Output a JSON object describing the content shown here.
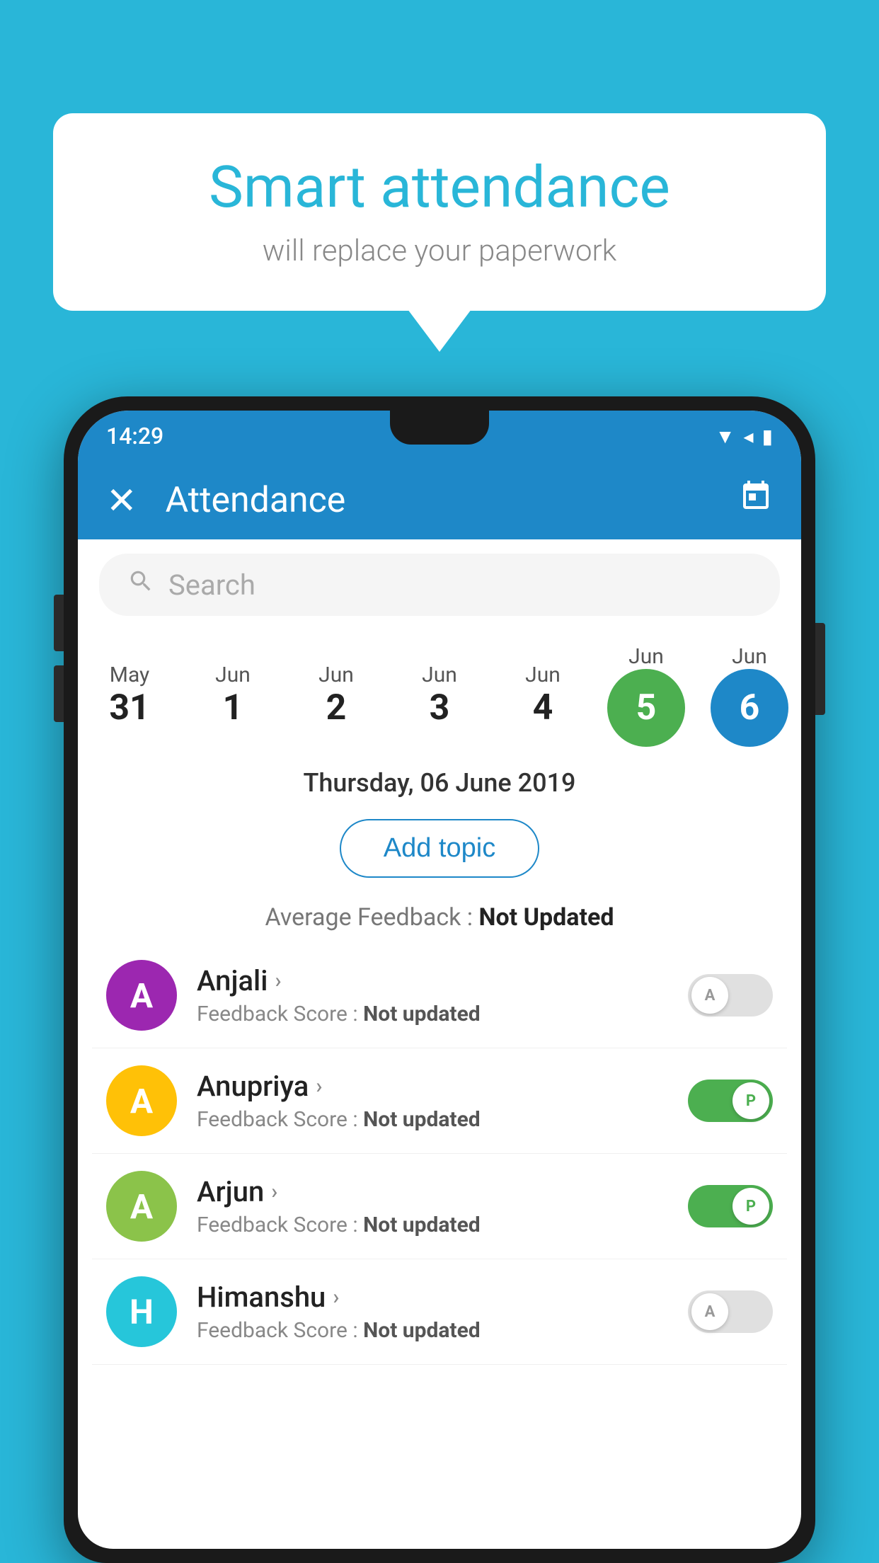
{
  "background_color": "#29b6d8",
  "speech_bubble": {
    "title": "Smart attendance",
    "subtitle": "will replace your paperwork"
  },
  "status_bar": {
    "time": "14:29",
    "icons": [
      "▼",
      "◀",
      "▮"
    ]
  },
  "app_bar": {
    "title": "Attendance",
    "close_label": "✕",
    "calendar_label": "📅"
  },
  "search": {
    "placeholder": "Search"
  },
  "calendar": {
    "days": [
      {
        "month": "May",
        "day": "31",
        "highlight": null
      },
      {
        "month": "Jun",
        "day": "1",
        "highlight": null
      },
      {
        "month": "Jun",
        "day": "2",
        "highlight": null
      },
      {
        "month": "Jun",
        "day": "3",
        "highlight": null
      },
      {
        "month": "Jun",
        "day": "4",
        "highlight": null
      },
      {
        "month": "Jun",
        "day": "5",
        "highlight": "green"
      },
      {
        "month": "Jun",
        "day": "6",
        "highlight": "blue"
      }
    ],
    "selected_date": "Thursday, 06 June 2019"
  },
  "add_topic": {
    "label": "Add topic"
  },
  "average_feedback": {
    "label": "Average Feedback :",
    "value": "Not Updated"
  },
  "students": [
    {
      "name": "Anjali",
      "avatar_letter": "A",
      "avatar_color": "purple",
      "feedback_label": "Feedback Score :",
      "feedback_value": "Not updated",
      "toggle_state": "off",
      "toggle_letter": "A"
    },
    {
      "name": "Anupriya",
      "avatar_letter": "A",
      "avatar_color": "yellow",
      "feedback_label": "Feedback Score :",
      "feedback_value": "Not updated",
      "toggle_state": "on",
      "toggle_letter": "P"
    },
    {
      "name": "Arjun",
      "avatar_letter": "A",
      "avatar_color": "light-green",
      "feedback_label": "Feedback Score :",
      "feedback_value": "Not updated",
      "toggle_state": "on",
      "toggle_letter": "P"
    },
    {
      "name": "Himanshu",
      "avatar_letter": "H",
      "avatar_color": "teal",
      "feedback_label": "Feedback Score :",
      "feedback_value": "Not updated",
      "toggle_state": "off",
      "toggle_letter": "A"
    }
  ]
}
